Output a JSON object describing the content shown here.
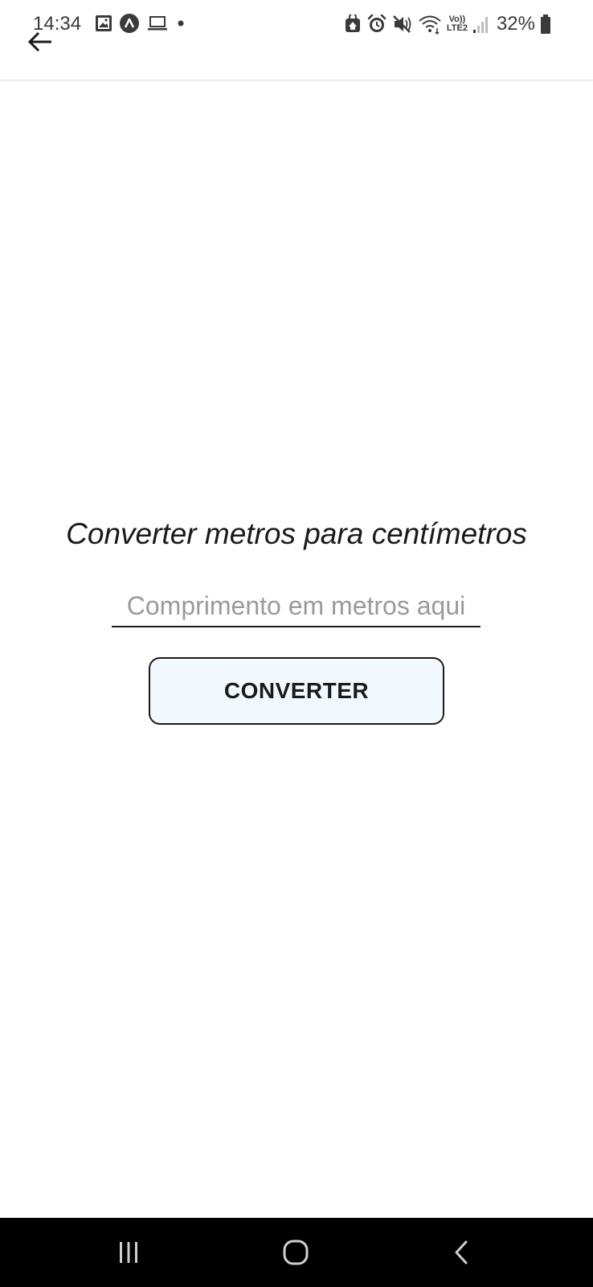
{
  "status_bar": {
    "time": "14:34",
    "battery": "32%",
    "left_icons": [
      "gallery-icon",
      "maps-icon",
      "laptop-icon",
      "notification-dot-icon"
    ],
    "right_icons": [
      "secure-folder-icon",
      "alarm-icon",
      "mute-icon",
      "wifi-icon",
      "volte-lte2-icon",
      "signal-icon",
      "battery-icon"
    ],
    "network_label_top": "Vo))",
    "network_label_bottom": "LTE2"
  },
  "app_bar": {
    "back_icon": "arrow-left-icon"
  },
  "main": {
    "title": "Converter metros para centímetros",
    "input": {
      "placeholder": "Comprimento em metros aqui",
      "value": ""
    },
    "convert_button_label": "CONVERTER"
  },
  "nav_bar": {
    "items": [
      "recents-icon",
      "home-icon",
      "back-icon"
    ]
  },
  "colors": {
    "background": "#ffffff",
    "button_background": "#f2f9fe",
    "text": "#1a1a1a",
    "placeholder": "#9a9a9a",
    "nav_bar": "#000000"
  }
}
